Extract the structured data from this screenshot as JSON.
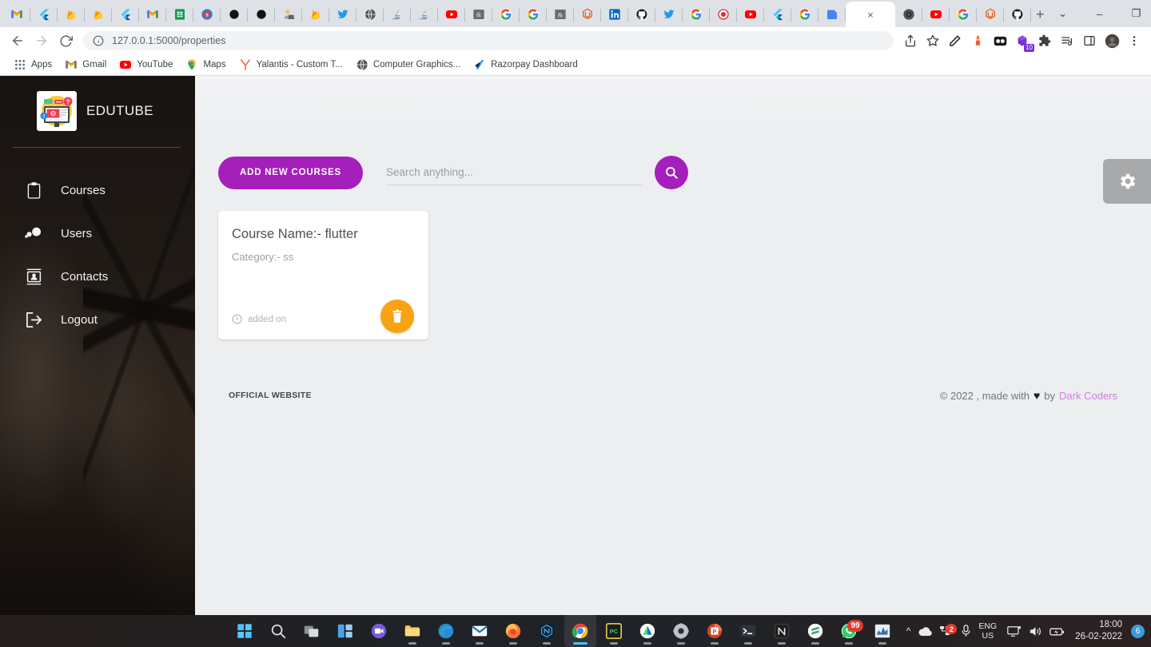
{
  "browser": {
    "tabs": [
      {
        "icon": "gmail-icon"
      },
      {
        "icon": "flutter-icon"
      },
      {
        "icon": "firebase-icon"
      },
      {
        "icon": "firebase-icon"
      },
      {
        "icon": "flutter-icon"
      },
      {
        "icon": "gmail-icon"
      },
      {
        "icon": "sheets-icon"
      },
      {
        "icon": "blue-globe-icon"
      },
      {
        "icon": "black-circle-icon"
      },
      {
        "icon": "black-circle-icon"
      },
      {
        "icon": "person-laptop-icon"
      },
      {
        "icon": "firebase-icon"
      },
      {
        "icon": "twitter-icon"
      },
      {
        "icon": "globe-icon"
      },
      {
        "icon": "java-icon"
      },
      {
        "icon": "java-icon"
      },
      {
        "icon": "youtube-icon"
      },
      {
        "icon": "geeksforgeeks-icon"
      },
      {
        "icon": "google-icon"
      },
      {
        "icon": "google-icon"
      },
      {
        "icon": "ampersand-icon"
      },
      {
        "icon": "unstop-icon"
      },
      {
        "icon": "linkedin-icon"
      },
      {
        "icon": "github-icon"
      },
      {
        "icon": "twitter-icon"
      },
      {
        "icon": "google-icon"
      },
      {
        "icon": "record-icon"
      },
      {
        "icon": "youtube-icon"
      },
      {
        "icon": "flutter-icon"
      },
      {
        "icon": "google-icon"
      },
      {
        "icon": "blue-doc-icon"
      }
    ],
    "active_tab": {
      "icon": "close-icon",
      "label": "×"
    },
    "tabs_right": [
      {
        "icon": "chrome-dev-icon"
      },
      {
        "icon": "youtube-icon"
      },
      {
        "icon": "google-icon"
      },
      {
        "icon": "unstop-icon"
      },
      {
        "icon": "github-icon"
      }
    ],
    "new_tab_label": "+",
    "window_controls": {
      "dropdown": "⌄",
      "minimize": "–",
      "maximize": "❐",
      "close": "✕"
    },
    "nav": {
      "back": "←",
      "forward": "→",
      "reload": "⟳"
    },
    "omnibox": {
      "url": "127.0.0.1:5000/properties",
      "info_icon": "info-circle-icon"
    },
    "toolbar_icons": [
      {
        "name": "share-icon"
      },
      {
        "name": "bookmark-star-icon"
      },
      {
        "name": "pen-icon"
      },
      {
        "name": "lighthouse-icon"
      },
      {
        "name": "dark-reader-icon"
      },
      {
        "name": "purple-extension-icon",
        "badge": "10"
      },
      {
        "name": "puzzle-extensions-icon"
      },
      {
        "name": "playlist-icon"
      },
      {
        "name": "sidepanel-icon"
      },
      {
        "name": "profile-avatar"
      },
      {
        "name": "kebab-menu-icon"
      }
    ],
    "bookmarks": [
      {
        "label": "Apps",
        "icon": "apps-grid-icon"
      },
      {
        "label": "Gmail",
        "icon": "gmail-icon"
      },
      {
        "label": "YouTube",
        "icon": "youtube-icon"
      },
      {
        "label": "Maps",
        "icon": "maps-pin-icon"
      },
      {
        "label": "Yalantis - Custom T...",
        "icon": "yalantis-icon"
      },
      {
        "label": "Computer Graphics...",
        "icon": "globe-icon"
      },
      {
        "label": "Razorpay Dashboard",
        "icon": "razorpay-icon"
      }
    ]
  },
  "app": {
    "sidebar": {
      "brand_name": "EDUTUBE",
      "brand_logo_icon": "elearning-logo-icon",
      "items": [
        {
          "label": "Courses",
          "icon": "clipboard-icon"
        },
        {
          "label": "Users",
          "icon": "users-icon"
        },
        {
          "label": "Contacts",
          "icon": "contact-card-icon"
        },
        {
          "label": "Logout",
          "icon": "logout-arrow-icon"
        }
      ]
    },
    "toolbar": {
      "add_button_label": "ADD NEW COURSES",
      "search_placeholder": "Search anything...",
      "search_value": "",
      "search_icon": "search-icon"
    },
    "cards": [
      {
        "title": "Course Name:- flutter",
        "category": "Category:- ss",
        "added_label": "added on",
        "clock_icon": "clock-icon",
        "delete_icon": "trash-icon"
      }
    ],
    "footer": {
      "left_label": "OFFICIAL WEBSITE",
      "copyright": "© 2022 , made with",
      "heart": "♥",
      "by": "by",
      "brand_link": "Dark Coders"
    },
    "floating_settings": {
      "icon": "gear-icon"
    },
    "colors": {
      "accent_purple": "#a51fbb",
      "accent_orange": "#f9a213",
      "page_bg": "#eceef0",
      "sidebar_dark": "#2b2320",
      "footer_link": "#d17fe0"
    }
  },
  "taskbar": {
    "apps": [
      {
        "name": "start-windows-icon"
      },
      {
        "name": "search-icon"
      },
      {
        "name": "task-view-icon"
      },
      {
        "name": "widgets-icon"
      },
      {
        "name": "teams-chat-icon"
      },
      {
        "name": "file-explorer-icon"
      },
      {
        "name": "edge-icon"
      },
      {
        "name": "mail-icon"
      },
      {
        "name": "firefox-icon"
      },
      {
        "name": "nodejs-icon"
      },
      {
        "name": "chrome-icon"
      },
      {
        "name": "pycharm-icon"
      },
      {
        "name": "android-studio-icon"
      },
      {
        "name": "settings-gear-icon"
      },
      {
        "name": "powerpoint-icon"
      },
      {
        "name": "terminal-icon"
      },
      {
        "name": "notion-icon"
      },
      {
        "name": "sublime-icon"
      },
      {
        "name": "whatsapp-icon",
        "badge": "99"
      },
      {
        "name": "analytics-icon"
      }
    ],
    "tray": {
      "chevron": "^",
      "onedrive_icon": "onedrive-icon",
      "network_icon": "network-icon",
      "network_badge": "2",
      "mic_icon": "microphone-icon",
      "language_line1": "ENG",
      "language_line2": "US",
      "display_icon": "display-icon",
      "volume_icon": "volume-icon",
      "battery_icon": "battery-icon",
      "time": "18:00",
      "date": "26-02-2022",
      "notification_count": "6"
    }
  }
}
